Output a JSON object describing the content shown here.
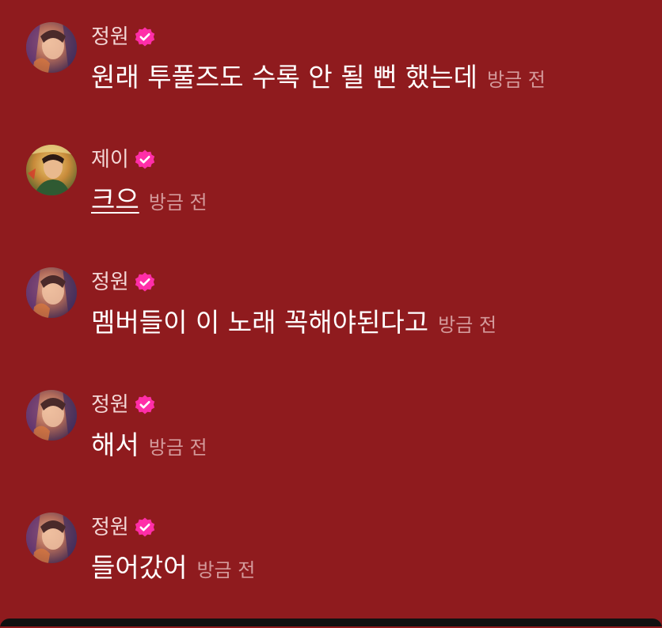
{
  "theme": {
    "background": "#8f1b1e",
    "username_color": "#f3d7d6",
    "message_color": "#ffffff",
    "timestamp_color": "#d49a9b",
    "verified_color": "#ff2ea8"
  },
  "messages": [
    {
      "avatar_icon": "user-avatar-jungwon",
      "username": "정원",
      "verified_icon": "verified-badge-icon",
      "text": "원래 투풀즈도 수록 안 될 뻔 했는데",
      "timestamp": "방금 전"
    },
    {
      "avatar_icon": "user-avatar-jay",
      "username": "제이",
      "verified_icon": "verified-badge-icon",
      "text": "크으",
      "timestamp": "방금 전"
    },
    {
      "avatar_icon": "user-avatar-jungwon",
      "username": "정원",
      "verified_icon": "verified-badge-icon",
      "text": "멤버들이 이 노래 꼭해야된다고",
      "timestamp": "방금 전"
    },
    {
      "avatar_icon": "user-avatar-jungwon",
      "username": "정원",
      "verified_icon": "verified-badge-icon",
      "text": "해서",
      "timestamp": "방금 전"
    },
    {
      "avatar_icon": "user-avatar-jungwon",
      "username": "정원",
      "verified_icon": "verified-badge-icon",
      "text": "들어갔어",
      "timestamp": "방금 전"
    }
  ]
}
